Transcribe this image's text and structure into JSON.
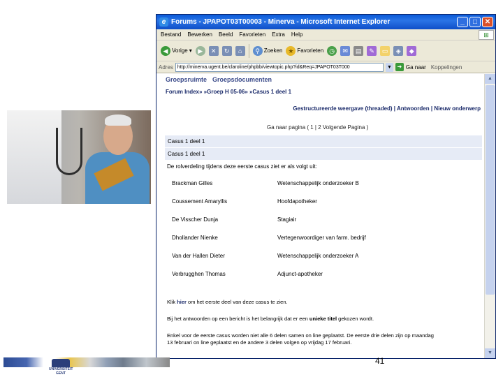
{
  "browser": {
    "title": "Forums - JPAPOT03T00003 - Minerva - Microsoft Internet Explorer",
    "menu": [
      "Bestand",
      "Bewerken",
      "Beeld",
      "Favorieten",
      "Extra",
      "Help"
    ],
    "toolbar": {
      "back": "Vorige",
      "search": "Zoeken",
      "favorites": "Favorieten"
    },
    "address": {
      "label": "Adres",
      "url": "http://minerva.ugent.be/claroline/phpbb/viewtopic.php?id&Req=JPAPOT03T000",
      "go": "Ga naar",
      "links": "Koppelingen"
    }
  },
  "page": {
    "top_links": [
      "Groepsruimte",
      "Groepsdocumenten"
    ],
    "breadcrumb": "Forum Index» »Groep H 05-06» »Casus 1 deel 1",
    "view_links": "Gestructureerde weergave (threaded) | Antwoorden | Nieuw onderwerp",
    "pager": "Ga naar pagina ( 1 | 2 Volgende Pagina )",
    "posts": [
      "Casus 1 deel 1",
      "Casus 1 deel 1"
    ],
    "intro": "De rolverdeling tijdens deze eerste casus ziet er als volgt uit:",
    "roles": [
      {
        "name": "Brackman Gilles",
        "function": "Wetenschappelijk onderzoeker B"
      },
      {
        "name": "Coussement Amaryllis",
        "function": "Hoofdapotheker"
      },
      {
        "name": "De Visscher Dunja",
        "function": "Stagiair"
      },
      {
        "name": "Dhollander Nienke",
        "function": "Vertegenwoordiger van farm. bedrijf"
      },
      {
        "name": "Van der Hallen Dieter",
        "function": "Wetenschappelijk onderzoeker A"
      },
      {
        "name": "Verbrugghen Thomas",
        "function": "Adjunct-apotheker"
      }
    ],
    "note1": {
      "pre": "Klik ",
      "link": "hier",
      "post": " om het eerste deel van deze casus te zien."
    },
    "note2": {
      "pre": "Bij het antwoorden op een bericht is het belangrijk dat er een ",
      "kw": "unieke titel",
      "post": " gekozen wordt."
    },
    "note3": "Enkel voor de eerste casus worden niet alle 6 delen samen on line geplaatst. De eerste drie delen zijn op maandag",
    "note4": "13 februari on line geplaatst en de andere 3 delen volgen op vrijdag 17 februari."
  },
  "slide": {
    "page_number": "41",
    "logo_text": "UNIVERSITEIT GENT"
  }
}
